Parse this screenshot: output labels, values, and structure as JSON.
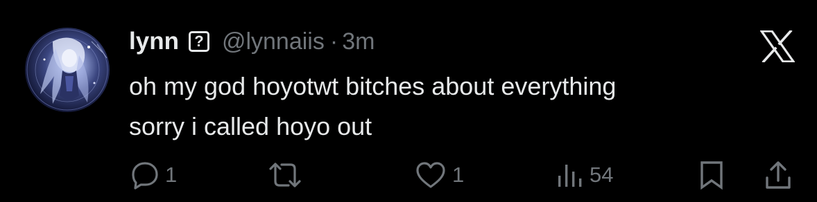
{
  "author": {
    "display_name": "lynn",
    "badge": "?",
    "handle": "@lynnaiis",
    "separator": "·",
    "time": "3m",
    "avatar_icon": "anime-avatar-icon"
  },
  "tweet": {
    "lines": [
      "oh my god hoyotwt bitches about everything",
      "sorry i called hoyo out"
    ]
  },
  "brand_icon": "x-logo-icon",
  "actions": {
    "reply": {
      "icon": "reply-icon",
      "count": "1"
    },
    "retweet": {
      "icon": "retweet-icon",
      "count": ""
    },
    "like": {
      "icon": "heart-icon",
      "count": "1"
    },
    "views": {
      "icon": "views-icon",
      "count": "54"
    },
    "bookmark": {
      "icon": "bookmark-icon"
    },
    "share": {
      "icon": "share-icon"
    }
  },
  "colors": {
    "background": "#000000",
    "primary_text": "#e7e9ea",
    "secondary_text": "#71767b"
  }
}
